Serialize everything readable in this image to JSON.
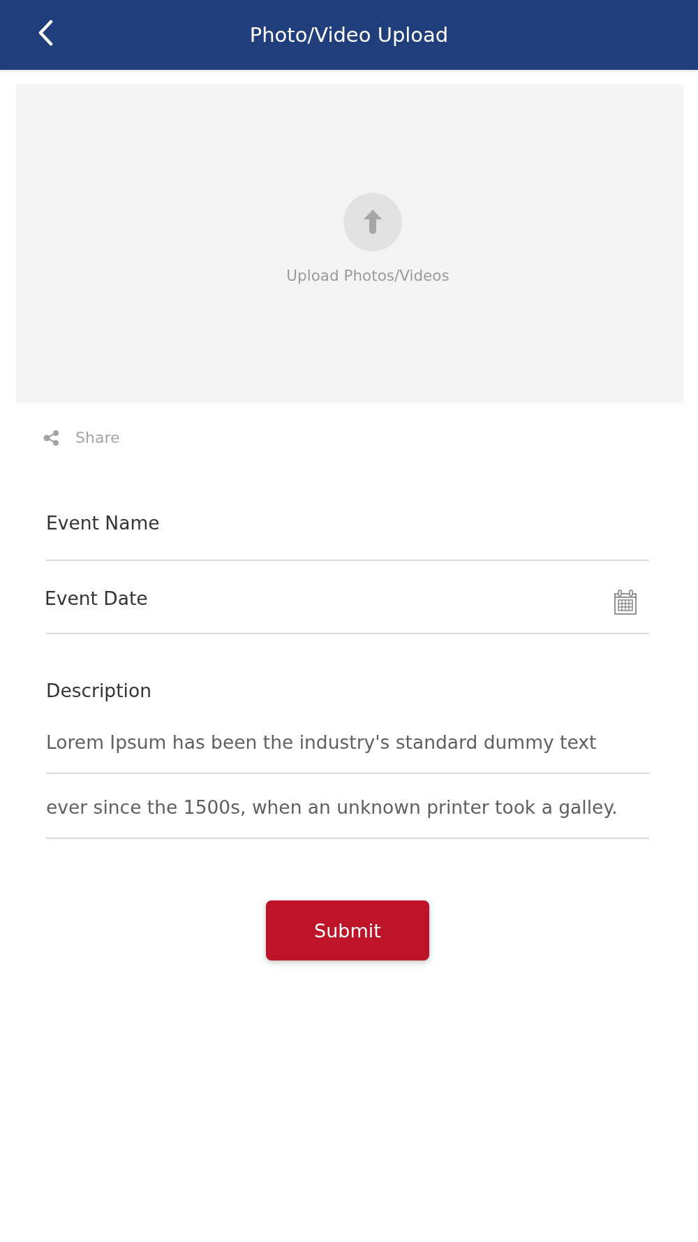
{
  "header": {
    "title": "Photo/Video Upload"
  },
  "upload_area": {
    "label": "Upload Photos/Videos"
  },
  "share": {
    "label": "Share"
  },
  "form": {
    "fields": [
      {
        "kind": "text",
        "placeholder": "Event Name"
      },
      {
        "kind": "date",
        "placeholder": "Event Date"
      }
    ],
    "description": {
      "label": "Description",
      "lines": [
        "Lorem Ipsum has been the industry's standard dummy text",
        "ever since the 1500s, when an unknown printer took a galley."
      ]
    }
  },
  "submit": {
    "label": "Submit"
  }
}
